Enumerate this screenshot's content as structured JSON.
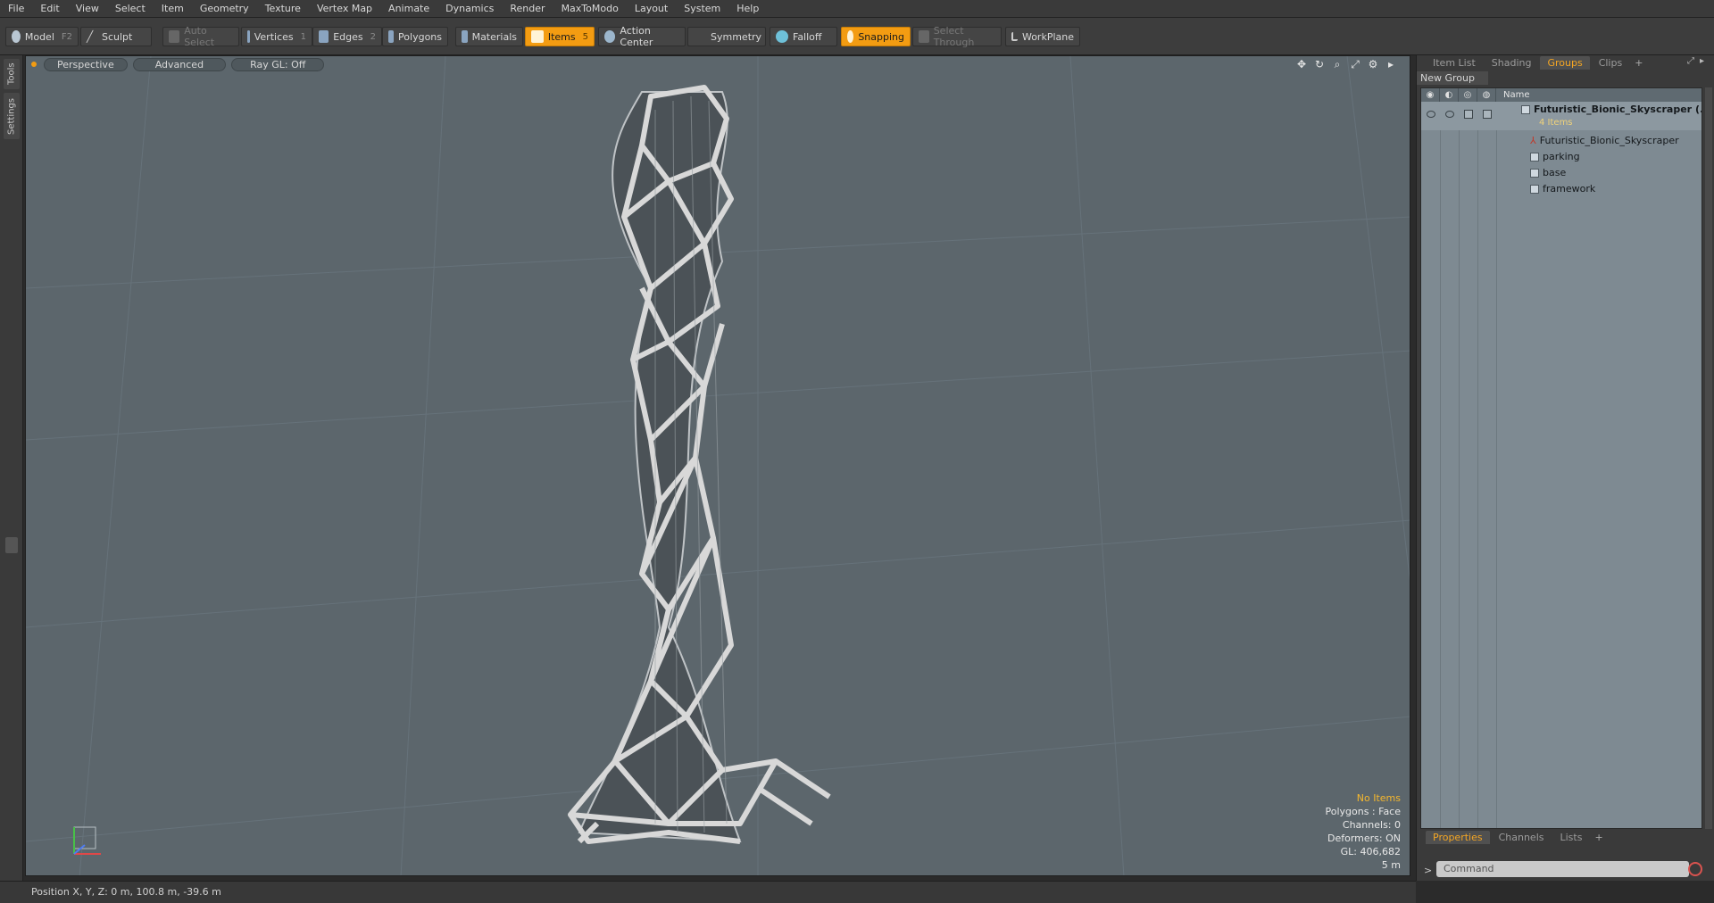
{
  "menu": [
    "File",
    "Edit",
    "View",
    "Select",
    "Item",
    "Geometry",
    "Texture",
    "Vertex Map",
    "Animate",
    "Dynamics",
    "Render",
    "MaxToModo",
    "Layout",
    "System",
    "Help"
  ],
  "toolbar": {
    "model": {
      "label": "Model",
      "key": "F2"
    },
    "sculpt": {
      "label": "Sculpt"
    },
    "auto_select": {
      "label": "Auto Select"
    },
    "vertices": {
      "label": "Vertices",
      "key": "1"
    },
    "edges": {
      "label": "Edges",
      "key": "2"
    },
    "polygons": {
      "label": "Polygons"
    },
    "materials": {
      "label": "Materials"
    },
    "items": {
      "label": "Items",
      "key": "5"
    },
    "action_center": {
      "label": "Action Center"
    },
    "symmetry": {
      "label": "Symmetry"
    },
    "falloff": {
      "label": "Falloff"
    },
    "snapping": {
      "label": "Snapping"
    },
    "select_through": {
      "label": "Select Through"
    },
    "workplane": {
      "label": "WorkPlane"
    }
  },
  "left_tabs": {
    "tools": "Tools",
    "settings": "Settings"
  },
  "viewport": {
    "view": "Perspective",
    "shading": "Advanced",
    "raygl": "Ray GL: Off",
    "info": {
      "items": "No Items",
      "polygons": "Polygons : Face",
      "channels": "Channels: 0",
      "deformers": "Deformers: ON",
      "gl": "GL: 406,682",
      "scale": "5 m"
    }
  },
  "status": {
    "position": "Position X, Y, Z:  0 m, 100.8 m, -39.6 m"
  },
  "panel": {
    "tabs": [
      "Item List",
      "Shading",
      "Groups",
      "Clips"
    ],
    "active_tab": "Groups",
    "new_group": "New Group",
    "column_name": "Name",
    "group": {
      "name": "Futuristic_Bionic_Skyscraper",
      "suffix": "(...",
      "count": "4 Items"
    },
    "children": [
      "Futuristic_Bionic_Skyscraper",
      "parking",
      "base",
      "framework"
    ],
    "bottom_tabs": [
      "Properties",
      "Channels",
      "Lists"
    ],
    "active_bottom_tab": "Properties",
    "command_placeholder": "Command"
  },
  "colors": {
    "accent": "#f39c12",
    "viewport_bg": "#5c666c",
    "panel_bg": "#7e8a92"
  }
}
